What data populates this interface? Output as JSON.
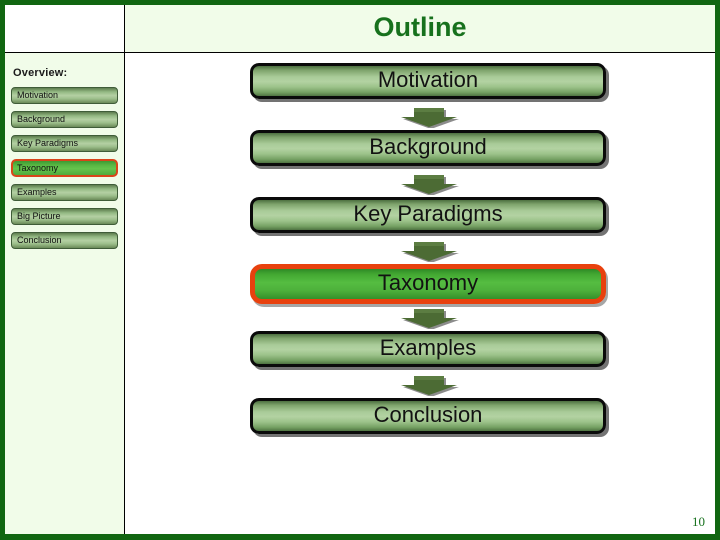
{
  "slide": {
    "title": "Outline",
    "page_number": "10",
    "accent_green": "#116611",
    "highlight_orange": "#e8410e",
    "pale_green_bg": "#f1fce9",
    "content_bg": "#ffffff"
  },
  "sidebar": {
    "heading": "Overview:",
    "items": [
      {
        "label": "Motivation",
        "active": false
      },
      {
        "label": "Background",
        "active": false
      },
      {
        "label": "Key Paradigms",
        "active": false
      },
      {
        "label": "Taxonomy",
        "active": true
      },
      {
        "label": "Examples",
        "active": false
      },
      {
        "label": "Big Picture",
        "active": false
      },
      {
        "label": "Conclusion",
        "active": false
      }
    ]
  },
  "flow": {
    "arrow_icon": "down-arrow-icon",
    "steps": [
      {
        "label": "Motivation",
        "active": false
      },
      {
        "label": "Background",
        "active": false
      },
      {
        "label": "Key Paradigms",
        "active": false
      },
      {
        "label": "Taxonomy",
        "active": true
      },
      {
        "label": "Examples",
        "active": false
      },
      {
        "label": "Conclusion",
        "active": false
      }
    ]
  }
}
